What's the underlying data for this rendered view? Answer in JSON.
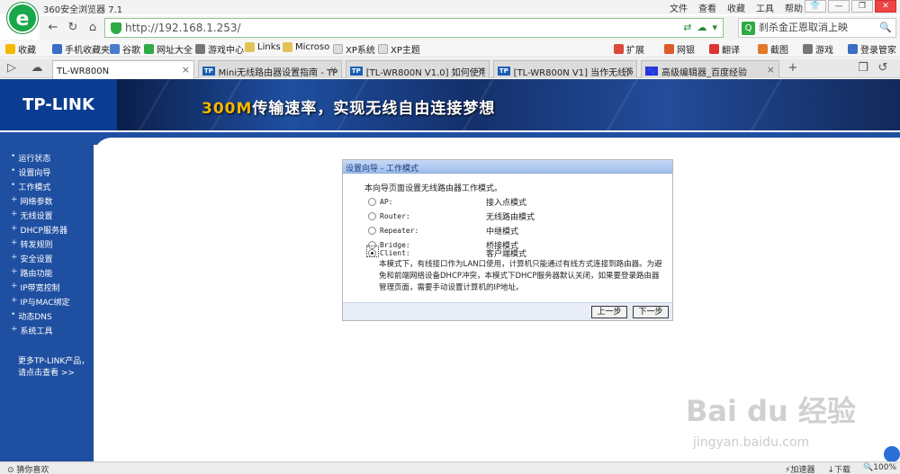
{
  "browser": {
    "app_title": "360安全浏览器 7.1",
    "menu": [
      "文件",
      "查看",
      "收藏",
      "工具",
      "帮助"
    ],
    "window_buttons": [
      "👕",
      "—",
      "❐",
      "✕"
    ],
    "address": "http://192.168.1.253/",
    "search_text": "刹杀金正恩取消上映",
    "favorites": [
      "收藏",
      "手机收藏夹",
      "谷歌",
      "网址大全",
      "游戏中心",
      "Links",
      "Microso",
      "XP系统",
      "XP主题"
    ],
    "right_tools": [
      "扩展",
      "网银",
      "翻译",
      "截图",
      "游戏",
      "登录管家"
    ],
    "tabs": [
      {
        "label": "TL-WR800N",
        "active": true
      },
      {
        "label": "Mini无线路由器设置指南 - TP-",
        "active": false
      },
      {
        "label": "[TL-WR800N V1.0] 如何使用",
        "active": false
      },
      {
        "label": "[TL-WR800N V1] 当作无线网",
        "active": false
      },
      {
        "label": "高级编辑器_百度经验",
        "active": false
      }
    ],
    "status_left": "猜你喜欢",
    "status_right": [
      "加速器",
      "下载",
      "100%"
    ]
  },
  "page": {
    "brand": "TP-LINK",
    "slogan_highlight": "300M",
    "slogan_rest": "传输速率，实现无线自由连接梦想",
    "sidebar_items": [
      "运行状态",
      "设置向导",
      "工作模式",
      "网络参数",
      "无线设置",
      "DHCP服务器",
      "转发规则",
      "安全设置",
      "路由功能",
      "IP带宽控制",
      "IP与MAC绑定",
      "动态DNS",
      "系统工具"
    ],
    "sidebar_more_line1": "更多TP-LINK产品，",
    "sidebar_more_line2": "请点击查看 >>",
    "wizard": {
      "title": "设置向导 - 工作模式",
      "intro": "本向导页面设置无线路由器工作模式。",
      "options": [
        {
          "name": "AP:",
          "desc": "接入点模式",
          "selected": false
        },
        {
          "name": "Router:",
          "desc": "无线路由模式",
          "selected": false
        },
        {
          "name": "Repeater:",
          "desc": "中继模式",
          "selected": false
        },
        {
          "name": "Bridge:",
          "desc": "桥接模式",
          "selected": false
        },
        {
          "name": "Client:",
          "desc": "客户端模式",
          "selected": true
        }
      ],
      "description": "本模式下，有线接口作为LAN口使用，计算机只能通过有线方式连接到路由器。为避免和前端网络设备DHCP冲突，本模式下DHCP服务器默认关闭，如果要登录路由器管理页面，需要手动设置计算机的IP地址。",
      "prev_label": "上一步",
      "next_label": "下一步"
    },
    "watermark_text": "Bai du 经验",
    "watermark_url": "jingyan.baidu.com"
  }
}
